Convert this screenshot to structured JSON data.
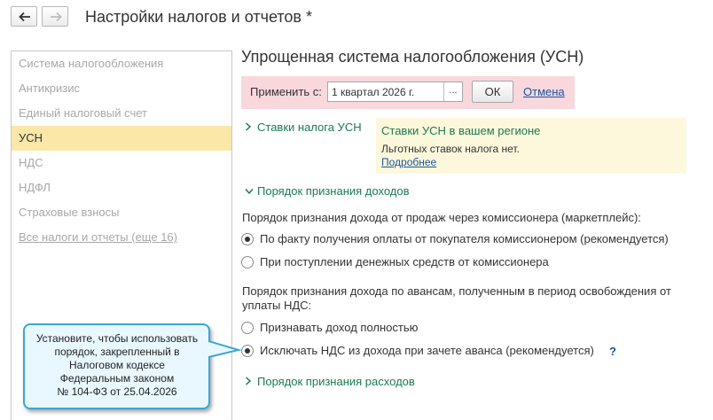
{
  "window": {
    "title": "Настройки налогов и отчетов *"
  },
  "sidebar": {
    "items": [
      {
        "label": "Система налогообложения"
      },
      {
        "label": "Антикризис"
      },
      {
        "label": "Единый налоговый счет"
      },
      {
        "label": "УСН"
      },
      {
        "label": "НДС"
      },
      {
        "label": "НДФЛ"
      },
      {
        "label": "Страховые взносы"
      },
      {
        "label": "Все налоги и отчеты (еще 16)"
      }
    ],
    "selected_index": 3
  },
  "main": {
    "section_title": "Упрощенная система налогообложения (УСН)",
    "apply": {
      "label": "Применить с:",
      "value": "1 квартал 2026 г.",
      "dots": "...",
      "ok_label": "ОК",
      "cancel_label": "Отмена"
    },
    "rates_group": {
      "label": "Ставки налога УСН",
      "expanded": false
    },
    "note": {
      "title": "Ставки УСН в вашем регионе",
      "text": "Льготных ставок налога нет.",
      "link": "Подробнее"
    },
    "income_group": {
      "label": "Порядок признания доходов",
      "expanded": true
    },
    "commission_question": "Порядок признания дохода от продаж через комиссионера (маркетплейс):",
    "commission_options": [
      {
        "label": "По факту получения оплаты от покупателя комиссионером (рекомендуется)",
        "checked": true
      },
      {
        "label": "При поступлении денежных средств от комиссионера",
        "checked": false
      }
    ],
    "advance_question_line1": "Порядок признания дохода по авансам, полученным в период освобождения от",
    "advance_question_line2": "уплаты НДС:",
    "advance_options": [
      {
        "label": "Признавать доход полностью",
        "checked": false
      },
      {
        "label": "Исключать НДС из дохода при зачете аванса (рекомендуется)",
        "checked": true
      }
    ],
    "help_label": "?",
    "expense_group": {
      "label": "Порядок признания расходов",
      "expanded": false
    }
  },
  "callout": {
    "text": "Установите, чтобы использовать\nпорядок, закрепленный в\nНалоговом кодексе\nФедеральным законом\n№ 104-ФЗ от 25.04.2026"
  },
  "colors": {
    "accent_green": "#1b7a52",
    "link_blue": "#1a55a0",
    "selected_bg": "#fbe7a8",
    "apply_bg": "#f8d7dd",
    "note_bg": "#fdf8dc",
    "callout_border": "#3aa6d4"
  }
}
